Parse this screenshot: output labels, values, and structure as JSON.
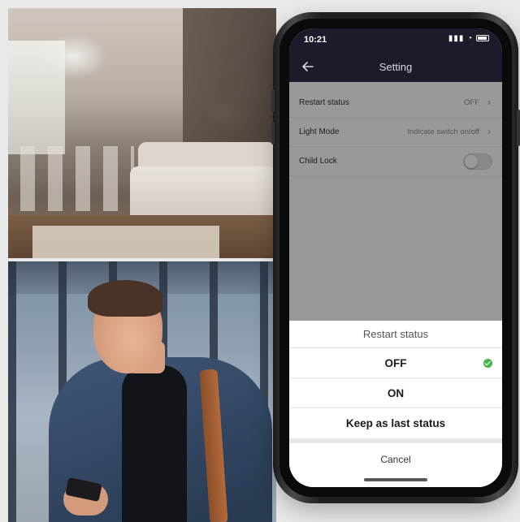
{
  "status_bar": {
    "time": "10:21",
    "signal": "▮▮▮",
    "wifi": "wifi"
  },
  "nav": {
    "title": "Setting",
    "back_icon": "‹"
  },
  "settings": [
    {
      "label": "Restart status",
      "value": "OFF",
      "type": "link"
    },
    {
      "label": "Light Mode",
      "value": "Indicate switch on/off",
      "type": "link"
    },
    {
      "label": "Child Lock",
      "value": "",
      "type": "toggle",
      "on": false
    }
  ],
  "sheet": {
    "title": "Restart status",
    "options": [
      {
        "label": "OFF",
        "selected": true
      },
      {
        "label": "ON",
        "selected": false
      },
      {
        "label": "Keep as last status",
        "selected": false
      }
    ],
    "cancel": "Cancel"
  },
  "colors": {
    "nav_bg": "#1d1b2b",
    "check": "#43b649"
  }
}
